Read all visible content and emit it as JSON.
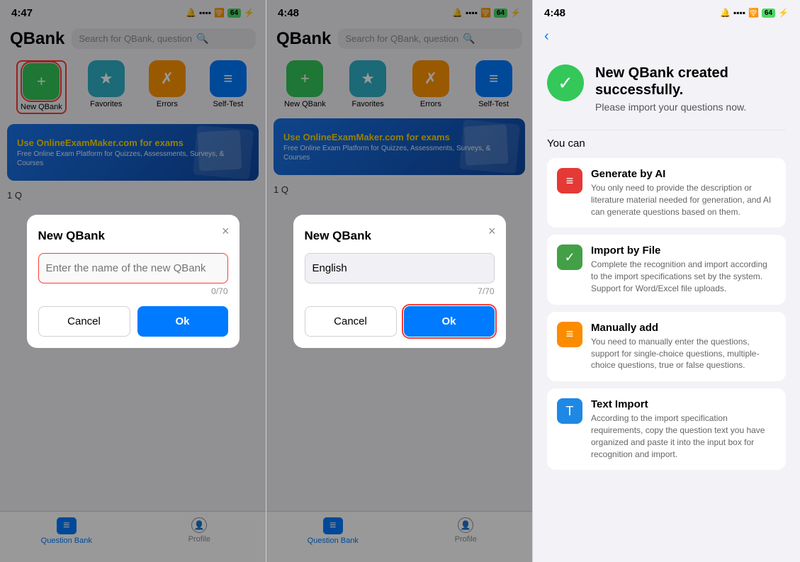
{
  "panel1": {
    "statusBar": {
      "time": "4:47",
      "battery": "64",
      "signal": "●●●●",
      "wifi": "wifi",
      "bell": "🔔"
    },
    "header": {
      "title": "QBank",
      "searchPlaceholder": "Search for QBank, question"
    },
    "icons": [
      {
        "id": "new-qbank",
        "label": "New QBank",
        "color": "green",
        "symbol": "+",
        "selected": true
      },
      {
        "id": "favorites",
        "label": "Favorites",
        "color": "teal",
        "symbol": "★"
      },
      {
        "id": "errors",
        "label": "Errors",
        "color": "orange",
        "symbol": "✗"
      },
      {
        "id": "self-test",
        "label": "Self-Test",
        "color": "blue",
        "symbol": "≡"
      }
    ],
    "banner": {
      "title": "Use OnlineExamMaker.com for exams",
      "subtitle": "Free Online Exam Platform for Quizzes,\nAssessments, Surveys, & Courses"
    },
    "modal": {
      "title": "New QBank",
      "inputPlaceholder": "Enter the name of the new QBank",
      "inputValue": "",
      "charCount": "0/70",
      "cancelLabel": "Cancel",
      "okLabel": "Ok"
    },
    "tabBar": {
      "items": [
        {
          "id": "question-bank",
          "label": "Question Bank",
          "active": true
        },
        {
          "id": "profile",
          "label": "Profile",
          "active": false
        }
      ]
    }
  },
  "panel2": {
    "statusBar": {
      "time": "4:48",
      "battery": "64",
      "signal": "●●●●",
      "wifi": "wifi",
      "bell": "🔔"
    },
    "header": {
      "title": "QBank",
      "searchPlaceholder": "Search for QBank, question"
    },
    "icons": [
      {
        "id": "new-qbank",
        "label": "New QBank",
        "color": "green",
        "symbol": "+"
      },
      {
        "id": "favorites",
        "label": "Favorites",
        "color": "teal",
        "symbol": "★"
      },
      {
        "id": "errors",
        "label": "Errors",
        "color": "orange",
        "symbol": "✗"
      },
      {
        "id": "self-test",
        "label": "Self-Test",
        "color": "blue",
        "symbol": "≡"
      }
    ],
    "banner": {
      "title": "Use OnlineExamMaker.com for exams",
      "subtitle": "Free Online Exam Platform for Quizzes,\nAssessments, Surveys, & Courses"
    },
    "modal": {
      "title": "New QBank",
      "inputValue": "English",
      "charCount": "7/70",
      "cancelLabel": "Cancel",
      "okLabel": "Ok",
      "okHighlighted": true
    },
    "tabBar": {
      "items": [
        {
          "id": "question-bank",
          "label": "Question Bank",
          "active": true
        },
        {
          "id": "profile",
          "label": "Profile",
          "active": false
        }
      ]
    }
  },
  "panel3": {
    "statusBar": {
      "time": "4:48",
      "battery": "64",
      "signal": "●●●●",
      "wifi": "wifi",
      "bell": "🔔"
    },
    "backLabel": "‹",
    "successTitle": "New QBank created\nsuccessfully.",
    "successSubtitle": "Please import your questions now.",
    "youCanLabel": "You can",
    "options": [
      {
        "id": "generate-ai",
        "color": "red",
        "symbol": "≡",
        "title": "Generate by AI",
        "description": "You only need to provide the description or literature material needed for generation, and AI can generate questions based on them."
      },
      {
        "id": "import-file",
        "color": "green",
        "symbol": "✓",
        "title": "Import by File",
        "description": "Complete the recognition and import according to the import specifications set by the system. Support for Word/Excel file uploads."
      },
      {
        "id": "manually-add",
        "color": "orange",
        "symbol": "≡",
        "title": "Manually add",
        "description": "You need to manually enter the questions, support for single-choice questions, multiple-choice questions, true or false questions."
      },
      {
        "id": "text-import",
        "color": "blue",
        "symbol": "T",
        "title": "Text Import",
        "description": "According to the import specification requirements, copy the question text you have organized and paste it into the input box for recognition and import."
      }
    ]
  }
}
